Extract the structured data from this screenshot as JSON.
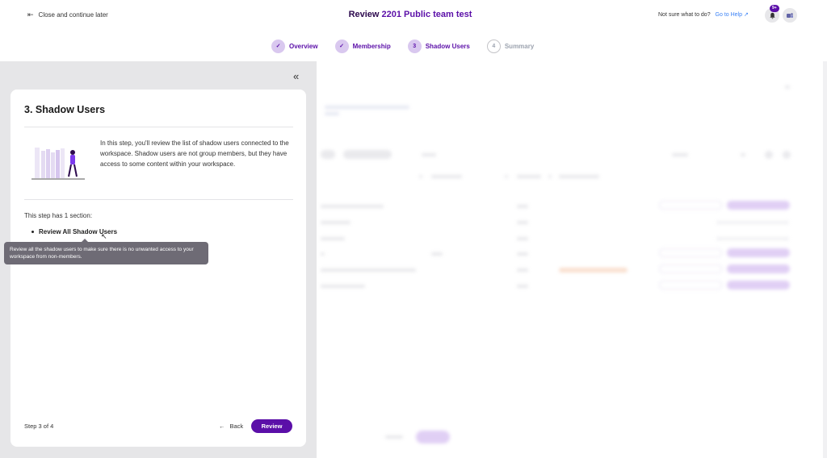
{
  "header": {
    "close_label": "Close and continue later",
    "title_prefix": "Review ",
    "title_name": "2201 Public team test",
    "help_text": "Not sure what to do?",
    "help_link": "Go to Help",
    "notification_badge": "9+"
  },
  "stepper": {
    "steps": [
      {
        "num": "✓",
        "label": "Overview",
        "state": "done"
      },
      {
        "num": "✓",
        "label": "Membership",
        "state": "done"
      },
      {
        "num": "3",
        "label": "Shadow Users",
        "state": "active"
      },
      {
        "num": "4",
        "label": "Summary",
        "state": "pending"
      }
    ]
  },
  "card": {
    "title": "3. Shadow Users",
    "description": "In this step, you'll review the list of shadow users connected to the workspace. Shadow users are not group members, but they have access to some content within your workspace.",
    "section_count": "This step has 1 section:",
    "section_item": "Review All Shadow Users",
    "tooltip": "Review all the shadow users to make sure there is no unwanted access to your workspace from non-members.",
    "step_of": "Step 3 of 4",
    "back_label": "Back",
    "review_label": "Review"
  },
  "colors": {
    "accent": "#5b0fa8",
    "accent_light": "#d9c8ef",
    "panel_bg": "#e6e6e8",
    "tooltip_bg": "#6e6b75",
    "help_link": "#3b82f6"
  },
  "icons": {
    "close": "exit-icon",
    "collapse": "double-chevron-left-icon",
    "bell": "bell-icon",
    "avatar": "teams-icon",
    "external": "external-link-icon",
    "back": "arrow-left-icon"
  }
}
